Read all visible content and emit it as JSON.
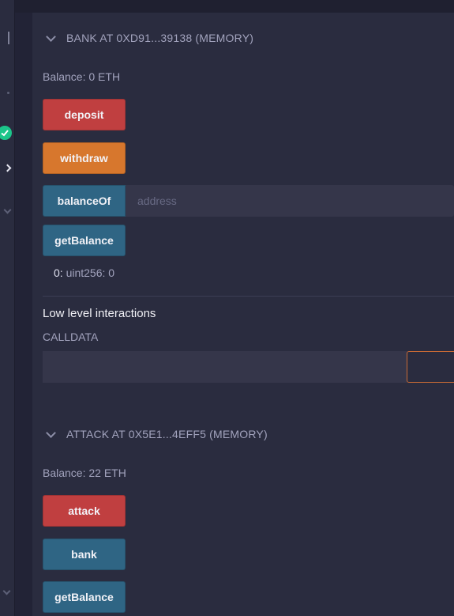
{
  "bank": {
    "title": "BANK AT 0XD91...39138 (MEMORY)",
    "balance": "Balance: 0 ETH",
    "buttons": {
      "deposit": "deposit",
      "withdraw": "withdraw",
      "balanceOf": "balanceOf",
      "getBalance": "getBalance"
    },
    "balanceOf_placeholder": "address",
    "output_key": "0:",
    "output_value": "uint256: 0",
    "low_level_title": "Low level interactions",
    "calldata_label": "CALLDATA",
    "calldata_value": ""
  },
  "attack": {
    "title": "ATTACK AT 0X5E1...4EFF5 (MEMORY)",
    "balance": "Balance: 22 ETH",
    "buttons": {
      "attack": "attack",
      "bank": "bank",
      "getBalance": "getBalance"
    }
  },
  "colors": {
    "background": "#222336",
    "panel": "#2a2c3f",
    "payable_button": "#c03f40",
    "nonpayable_button": "#d7772d",
    "view_button": "#2f6584",
    "check_badge": "#1cc58a"
  },
  "icons": [
    "file-icon",
    "plugin-icon",
    "compile-success-icon",
    "deploy-run-icon",
    "debugger-icon",
    "settings-chevron-icon",
    "collapse-chevron-icon"
  ]
}
